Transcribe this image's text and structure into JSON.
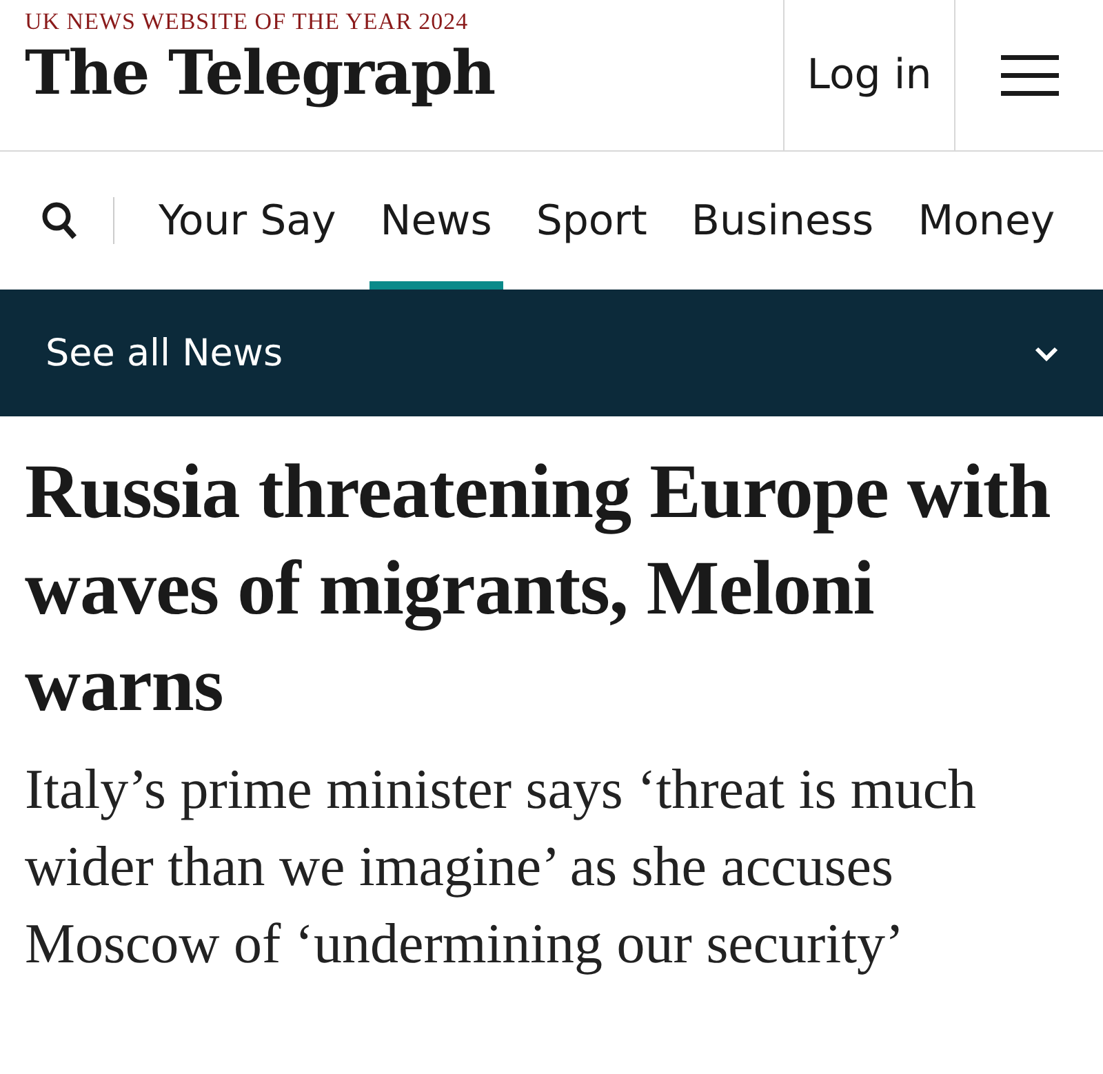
{
  "header": {
    "tagline": "UK NEWS WEBSITE OF THE YEAR 2024",
    "logo": "The Telegraph",
    "login": "Log in"
  },
  "nav": {
    "tabs": [
      {
        "label": "Your Say",
        "selected": false
      },
      {
        "label": "News",
        "selected": true
      },
      {
        "label": "Sport",
        "selected": false
      },
      {
        "label": "Business",
        "selected": false
      },
      {
        "label": "Money",
        "selected": false
      }
    ]
  },
  "section_bar": {
    "label": "See all News",
    "expanded": false
  },
  "article": {
    "headline": "Russia threatening Europe with waves of migrants, Meloni warns",
    "standfirst": "Italy’s prime minister says ‘threat is much wider than we imagine’ as she accuses Moscow of ‘undermining our security’"
  }
}
